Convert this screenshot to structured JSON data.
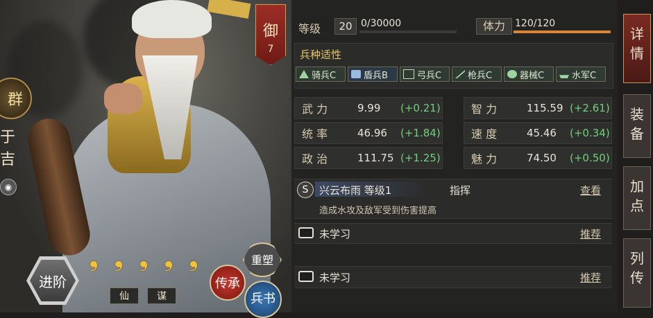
{
  "general": {
    "faction_char": "群",
    "name_chars": [
      "于",
      "吉"
    ],
    "grade_char": "御",
    "grade_num": "7",
    "tags": [
      "仙",
      "谋"
    ],
    "stars": 5
  },
  "buttons": {
    "advance": "进阶",
    "inherit": "传承",
    "rebuild": "重塑",
    "book": "兵书"
  },
  "level": {
    "label": "等级",
    "value": "20",
    "exp": "0/30000",
    "exp_fraction": 0.0
  },
  "stamina": {
    "label": "体力",
    "value": "120/120",
    "fraction": 1.0
  },
  "troop_aptitude": {
    "title": "兵种适性",
    "items": [
      "骑兵C",
      "盾兵B",
      "弓兵C",
      "枪兵C",
      "器械C",
      "水军C"
    ]
  },
  "stats": [
    {
      "label": "武 力",
      "value": "9.99",
      "bonus": "(+0.21)"
    },
    {
      "label": "智 力",
      "value": "115.59",
      "bonus": "(+2.61)"
    },
    {
      "label": "统 率",
      "value": "46.96",
      "bonus": "(+1.84)"
    },
    {
      "label": "速 度",
      "value": "45.46",
      "bonus": "(+0.34)"
    },
    {
      "label": "政 治",
      "value": "111.75",
      "bonus": "(+1.25)"
    },
    {
      "label": "魅 力",
      "value": "74.50",
      "bonus": "(+0.50)"
    }
  ],
  "skills": {
    "main": {
      "badge": "S",
      "name": "兴云布雨 等级1",
      "type": "指挥",
      "action": "查看",
      "desc": "造成水攻及敌军受到伤害提高"
    },
    "slot1": {
      "name": "未学习",
      "action": "推荐"
    },
    "slot2": {
      "name": "未学习",
      "action": "推荐"
    }
  },
  "side_tabs": [
    {
      "label": "详情",
      "chars": [
        "详",
        "情"
      ],
      "active": true
    },
    {
      "label": "装备",
      "chars": [
        "装",
        "备"
      ],
      "active": false
    },
    {
      "label": "加点",
      "chars": [
        "加",
        "点"
      ],
      "active": false
    },
    {
      "label": "列传",
      "chars": [
        "列",
        "传"
      ],
      "active": false
    }
  ],
  "colors": {
    "accent_orange": "#d9853a",
    "bonus_green": "#6fd17a",
    "grade_red": "#8a241d"
  }
}
